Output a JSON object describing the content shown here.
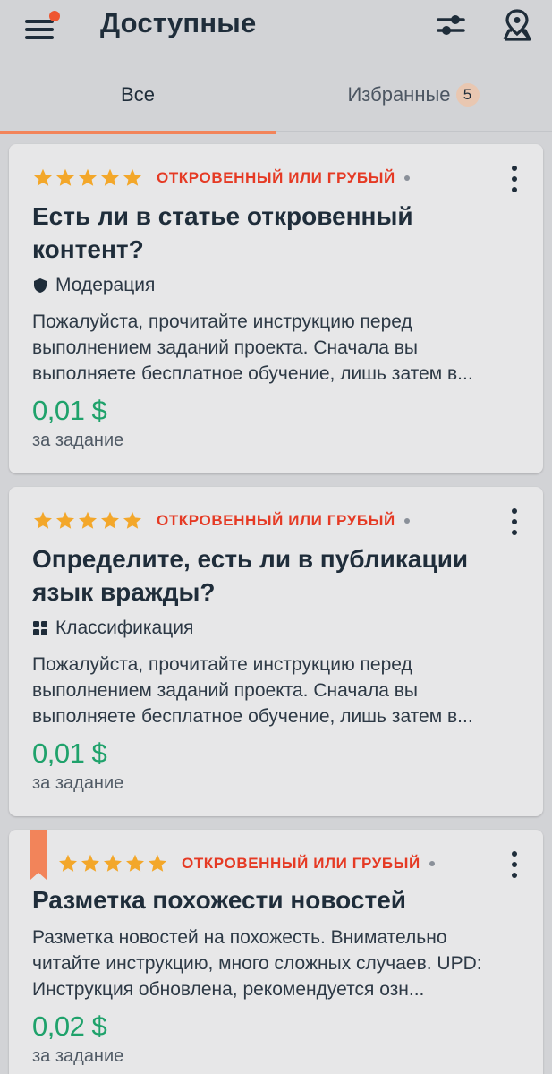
{
  "header": {
    "title": "Доступные",
    "menu_icon": "hamburger-menu-icon",
    "notification_color": "#ee5530",
    "filter_icon": "sliders-icon",
    "map_icon": "map-pin-icon"
  },
  "tabs": [
    {
      "label": "Все",
      "active": true
    },
    {
      "label": "Избранные",
      "count": "5",
      "active": false
    }
  ],
  "colors": {
    "accent": "#f2845a",
    "category_red": "#e53a24",
    "price_green": "#1fa26b",
    "star_gold": "#f3a72a"
  },
  "tasks": [
    {
      "rating": 5,
      "category": "ОТКРОВЕННЫЙ ИЛИ ГРУБЫЙ",
      "title": "Есть ли в статье откровенный контент?",
      "tag": "Модерация",
      "tag_icon": "shield-icon",
      "description": "Пожалуйста, прочитайте инструкцию перед выполнением заданий проекта. Сначала вы выполняете бесплатное обучение, лишь затем в...",
      "price": "0,01 $",
      "price_unit": "за задание"
    },
    {
      "rating": 5,
      "category": "ОТКРОВЕННЫЙ ИЛИ ГРУБЫЙ",
      "title": "Определите, есть ли в публикации язык вражды?",
      "tag": "Классификация",
      "tag_icon": "grid-icon",
      "description": "Пожалуйста, прочитайте инструкцию перед выполнением заданий проекта. Сначала вы выполняете бесплатное обучение, лишь затем в...",
      "price": "0,01 $",
      "price_unit": "за задание"
    },
    {
      "rating": 5,
      "category": "ОТКРОВЕННЫЙ ИЛИ ГРУБЫЙ",
      "title": "Разметка похожести новостей",
      "description": "Разметка новостей на похожесть. Внимательно читайте инструкцию, много сложных случаев. UPD: Инструкция обновлена, рекомендуется озн...",
      "price": "0,02 $",
      "price_unit": "за задание",
      "bookmarked": true
    }
  ]
}
